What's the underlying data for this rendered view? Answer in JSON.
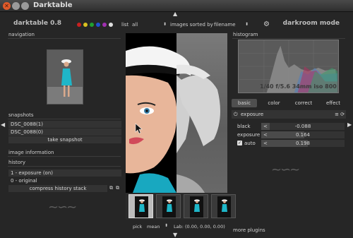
{
  "window": {
    "title": "Darktable"
  },
  "topbar": {
    "app_name": "darktable 0.8",
    "mode": "darkroom mode",
    "color_labels": [
      "#c82020",
      "#d8c020",
      "#20a030",
      "#2050d0",
      "#a030b0",
      "#dddddd"
    ],
    "filter_label": "list",
    "filter_value": "all",
    "sort_label": "images sorted by",
    "sort_value": "filename"
  },
  "left": {
    "navigation_title": "navigation",
    "snapshots_title": "snapshots",
    "snapshots": [
      "DSC_0088(1)",
      "DSC_0088(0)"
    ],
    "take_snapshot": "take snapshot",
    "image_info_title": "image information",
    "history_title": "history",
    "history_items": [
      "1 - exposure (on)",
      "0 - original"
    ],
    "compress_history": "compress history stack"
  },
  "right": {
    "histogram_title": "histogram",
    "histogram_info": "1/40 f/5.6 34mm iso 800",
    "tabs": [
      "basic",
      "color",
      "correct",
      "effect"
    ],
    "active_tab": "basic",
    "module_title": "exposure",
    "params": [
      {
        "label": "black",
        "value": "-0.088"
      },
      {
        "label": "exposure",
        "value": "0.164"
      },
      {
        "label": "auto",
        "value": "0.198"
      }
    ],
    "auto_checked": true,
    "more_plugins": "more plugins"
  },
  "bottom": {
    "pick_label": "pick",
    "pick_value": "mean",
    "lab_readout": "Lab: (0.00, 0.00, 0.00)"
  }
}
